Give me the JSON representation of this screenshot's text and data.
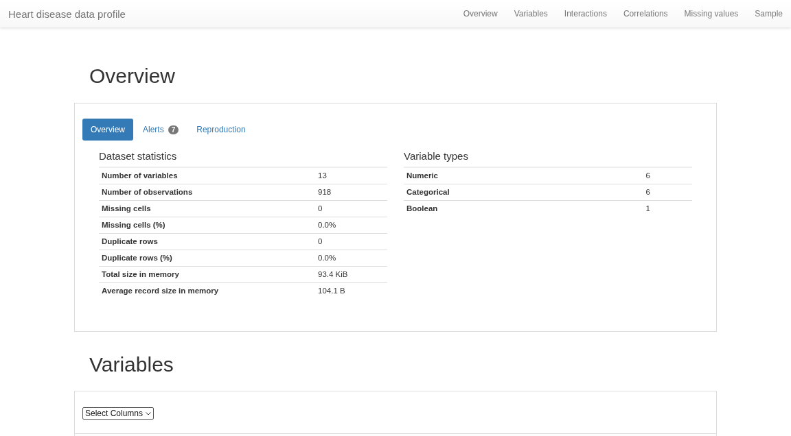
{
  "navbar": {
    "brand": "Heart disease data profile",
    "links": [
      "Overview",
      "Variables",
      "Interactions",
      "Correlations",
      "Missing values",
      "Sample"
    ]
  },
  "overview": {
    "heading": "Overview",
    "tabs": [
      {
        "label": "Overview",
        "selected": true
      },
      {
        "label": "Alerts",
        "badge": "7",
        "selected": false
      },
      {
        "label": "Reproduction",
        "selected": false
      }
    ],
    "dataset_statistics": {
      "title": "Dataset statistics",
      "rows": [
        {
          "label": "Number of variables",
          "value": "13"
        },
        {
          "label": "Number of observations",
          "value": "918"
        },
        {
          "label": "Missing cells",
          "value": "0"
        },
        {
          "label": "Missing cells (%)",
          "value": "0.0%"
        },
        {
          "label": "Duplicate rows",
          "value": "0"
        },
        {
          "label": "Duplicate rows (%)",
          "value": "0.0%"
        },
        {
          "label": "Total size in memory",
          "value": "93.4 KiB"
        },
        {
          "label": "Average record size in memory",
          "value": "104.1 B"
        }
      ]
    },
    "variable_types": {
      "title": "Variable types",
      "rows": [
        {
          "label": "Numeric",
          "value": "6"
        },
        {
          "label": "Categorical",
          "value": "6"
        },
        {
          "label": "Boolean",
          "value": "1"
        }
      ]
    }
  },
  "variables": {
    "heading": "Variables",
    "select": {
      "value": "Select Columns"
    }
  }
}
